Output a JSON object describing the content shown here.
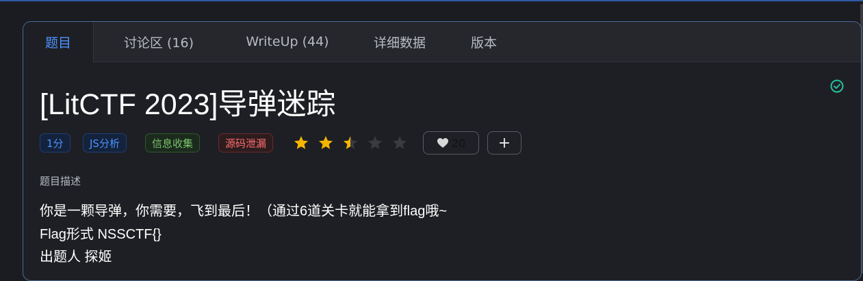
{
  "tabs": [
    {
      "label": "题目",
      "active": true
    },
    {
      "label": "讨论区 (16)",
      "active": false
    },
    {
      "label": "WriteUp (44)",
      "active": false
    },
    {
      "label": "详细数据",
      "active": false
    },
    {
      "label": "版本",
      "active": false
    }
  ],
  "challenge": {
    "title": "[LitCTF 2023]导弹迷踪",
    "solved_icon": "check-circle-icon",
    "points": "1分",
    "tags": [
      "JS分析",
      "信息收集",
      "源码泄漏"
    ],
    "rating": 2.5,
    "rating_max": 5,
    "likes": "20",
    "add_label": "+"
  },
  "description": {
    "label": "题目描述",
    "lines": [
      "你是一颗导弹，你需要，飞到最后！（通过6道关卡就能拿到flag哦~",
      "Flag形式 NSSCTF{}",
      "出题人 探姬"
    ]
  },
  "colors": {
    "accent": "#4c93ff",
    "star_on": "#f6b500",
    "star_off": "#3a3b40",
    "solved": "#25c2a0"
  }
}
